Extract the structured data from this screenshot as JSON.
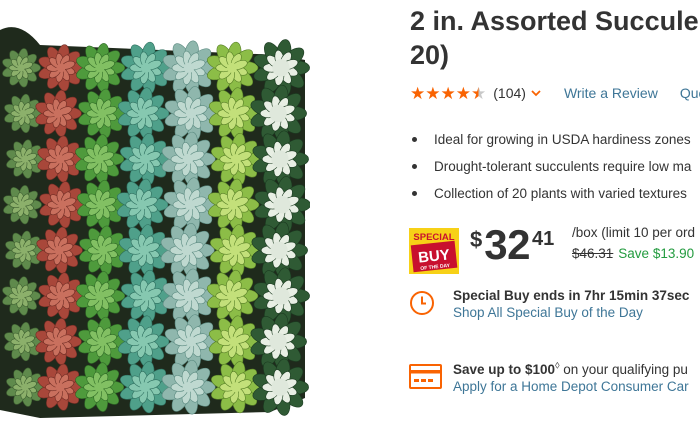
{
  "product": {
    "title_line1": "2 in. Assorted Succule",
    "title_line2": "20)",
    "image_alt": "Tray of assorted succulents"
  },
  "rating": {
    "value": 4.5,
    "max": 5,
    "count": "(104)",
    "write_review": "Write a Review",
    "questions": "Que"
  },
  "bullets": [
    "Ideal for growing in USDA hardiness zones",
    "Drought-tolerant succulents require low ma",
    "Collection of 20 plants with varied textures"
  ],
  "special_badge": {
    "line1": "SPECIAL",
    "line2": "BUY",
    "line3": "OF THE DAY"
  },
  "price": {
    "currency": "$",
    "dollars": "32",
    "cents": "41",
    "unit": "/box (limit 10 per ord",
    "was": "$46.31",
    "save": "Save $13.90"
  },
  "special_buy": {
    "ends_text": "Special Buy ends in 7hr 15min 37sec",
    "shop_link": "Shop All Special Buy of the Day"
  },
  "credit": {
    "save_bold": "Save up to $100",
    "save_mark": "◊",
    "save_rest": " on your qualifying pu",
    "apply_link": "Apply for a Home Depot Consumer Car"
  },
  "colors": {
    "brand_orange": "#f96302",
    "link_blue": "#3e7697",
    "save_green": "#239b3f",
    "badge_red": "#c8102e",
    "badge_yellow": "#f7d117"
  },
  "icons": {
    "review_dropdown": "chevron-down-icon",
    "timer": "clock-icon",
    "credit": "credit-card-icon"
  }
}
